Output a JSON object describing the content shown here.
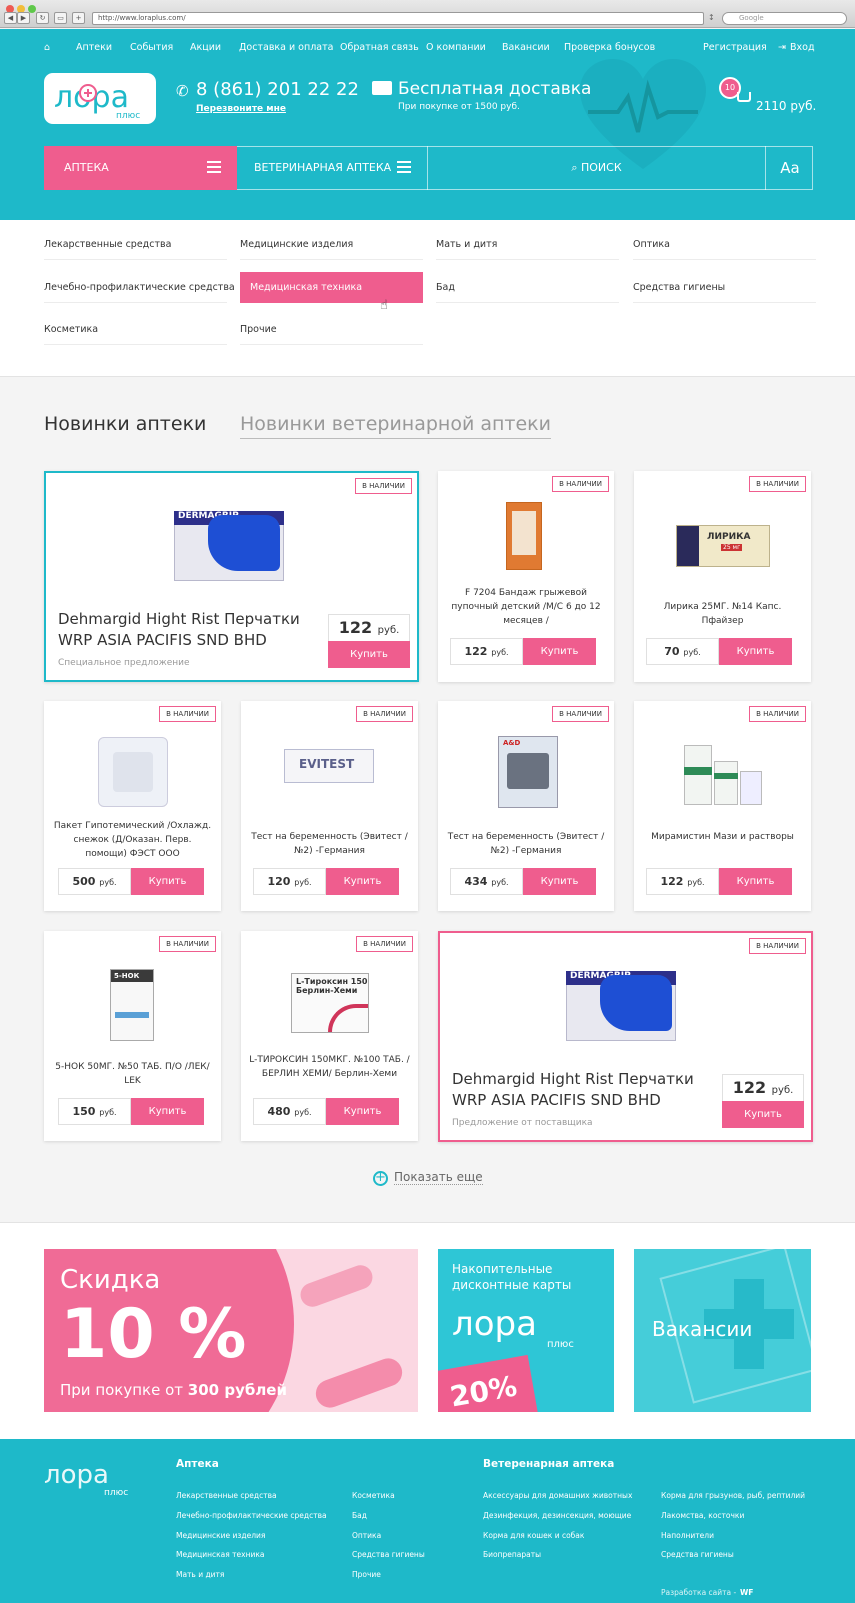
{
  "browser": {
    "url": "http://www.loraplus.com/",
    "search_placeholder": "Google"
  },
  "nav": {
    "home_icon": "home-icon",
    "items": [
      "Аптеки",
      "События",
      "Акции",
      "Доставка и оплата",
      "Обратная связь",
      "О компании",
      "Вакансии",
      "Проверка бонусов"
    ],
    "register": "Регистрация",
    "login": "Вход"
  },
  "logo": {
    "text": "лора",
    "sub": "плюс"
  },
  "contact": {
    "phone": "8 (861) 201 22 22",
    "callback": "Перезвоните мне"
  },
  "delivery": {
    "title": "Бесплатная доставка",
    "sub": "При покупке от 1500 руб."
  },
  "cart": {
    "count": "10",
    "total": "2110 руб."
  },
  "catbar": {
    "apteka": "АПТЕКА",
    "vet": "ВЕТЕРИНАРНАЯ АПТЕКА",
    "search": "ПОИСК",
    "font": "Aa"
  },
  "categories": [
    [
      "Лекарственные средства",
      "Медицинские изделия",
      "Мать и дитя",
      "Оптика"
    ],
    [
      "Лечебно-профилактические средства",
      "Медицинская техника",
      "Бад",
      "Средства гигиены"
    ],
    [
      "Косметика",
      "Прочие"
    ]
  ],
  "tabs": {
    "active": "Новинки аптеки",
    "inactive": "Новинки ветеринарной аптеки"
  },
  "stock_label": "В НАЛИЧИИ",
  "buy_label": "Купить",
  "currency": "руб.",
  "featured": [
    {
      "name": "Dehmargid Hight Rist Перчатки WRP ASIA PACIFIS SND BHD",
      "price": "122",
      "sub": "Специальное предложение"
    },
    {
      "name": "Dehmargid Hight Rist Перчатки WRP ASIA PACIFIS SND BHD",
      "price": "122",
      "sub": "Предложение от поставщика"
    }
  ],
  "products": [
    {
      "name": "F 7204 Бандаж грыжевой пупочный детский /М/С 6 до 12 месяцев /",
      "price": "122"
    },
    {
      "name": "Лирика 25МГ. №14 Капс. Пфайзер",
      "price": "70"
    },
    {
      "name": "Пакет Гипотемический /Охлажд. снежок (Д/Оказан. Перв. помощи) ФЭСТ ООО",
      "price": "500"
    },
    {
      "name": "Тест на беременность (Эвитест / №2) -Германия",
      "price": "120"
    },
    {
      "name": "Тест на беременность (Эвитест / №2) -Германия",
      "price": "434"
    },
    {
      "name": "Мирамистин Мази и растворы",
      "price": "122"
    },
    {
      "name": "5-НОК 50МГ. №50 ТАБ. П/О /ЛЕК/ LEK",
      "price": "150"
    },
    {
      "name": "L-ТИРОКСИН 150МКГ. №100 ТАБ. /БЕРЛИН ХЕМИ/ Берлин-Хеми",
      "price": "480"
    }
  ],
  "box_labels": {
    "gloves": "DERMAGRIP",
    "lyrica": "ЛИРИКА",
    "lyrica_dose": "25 мг",
    "evitest": "EVITEST",
    "tonometer": "A&D",
    "nok": "5-НОК",
    "thyroxin": "L-Тироксин 150",
    "thyroxin_maker": "Берлин-Хеми"
  },
  "show_more": "Показать еще",
  "banners": {
    "discount_title": "Скидка",
    "discount_value": "10 %",
    "discount_sub_pre": "При покупке от ",
    "discount_sub_bold": "300 рублей",
    "cards_title": "Накопительные дисконтные карты",
    "cards_pct": "20%",
    "jobs": "Вакансии"
  },
  "footer": {
    "apteka_title": "Аптека",
    "apteka_col1": [
      "Лекарственные средства",
      "Лечебно-профилактические средства",
      "Медицинские изделия",
      "Медицинская техника",
      "Мать и дитя"
    ],
    "apteka_col2": [
      "Косметика",
      "Бад",
      "Оптика",
      "Средства гигиены",
      "Прочие"
    ],
    "vet_title": "Ветеренарная аптека",
    "vet_col1": [
      "Аксессуары для домашних животных",
      "Дезинфекция, дезинсекция, моющие",
      "Корма для кошек и собак",
      "Биопрепараты"
    ],
    "vet_col2": [
      "Корма для грызунов, рыб, рептилий",
      "Лакомства, косточки",
      "Наполнители",
      "Средства гигиены"
    ],
    "dev_label": "Разработка сайта -",
    "dev_name": "WF"
  },
  "colors": {
    "teal": "#1eb9c9",
    "pink": "#ef5d8e"
  }
}
